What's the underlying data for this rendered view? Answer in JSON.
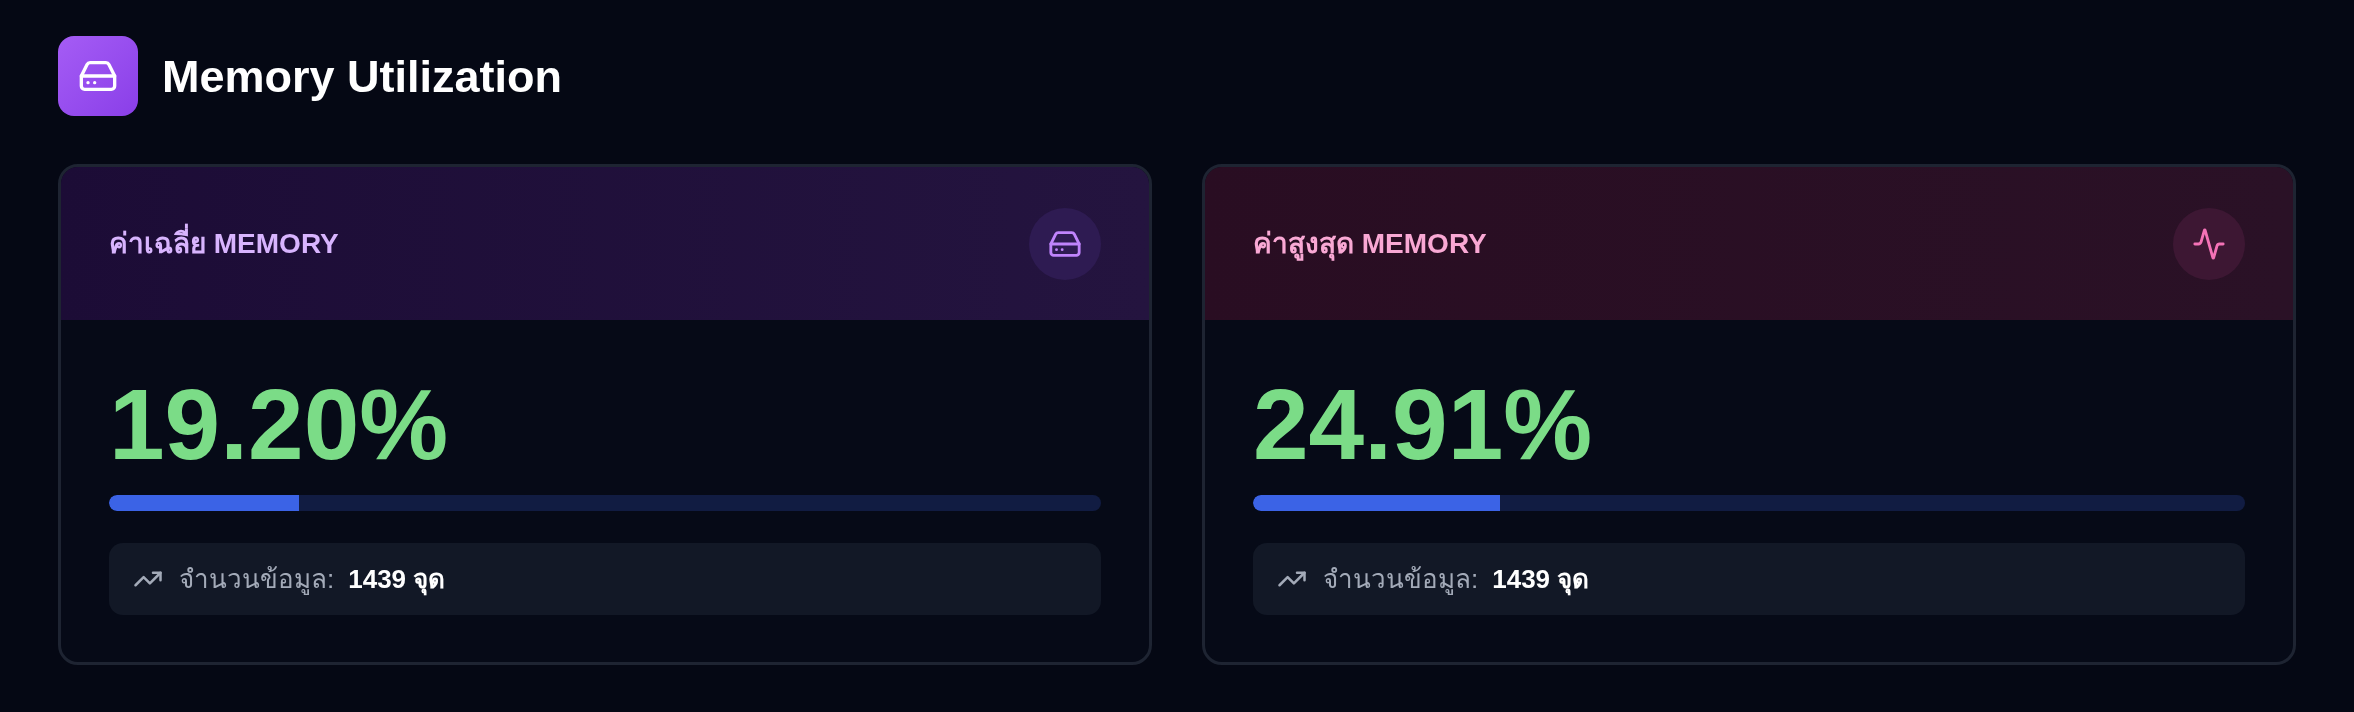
{
  "header": {
    "title": "Memory Utilization"
  },
  "cards": [
    {
      "kind": "average",
      "label": "ค่าเฉลี่ย MEMORY",
      "value": "19.20%",
      "level": 0.192,
      "count_label": "จำนวนข้อมูล:",
      "count_value": "1439 จุด"
    },
    {
      "kind": "peak",
      "label": "ค่าสูงสุด MEMORY",
      "value": "24.91%",
      "level": 0.2491,
      "count_label": "จำนวนข้อมูล:",
      "count_value": "1439 จุด"
    }
  ]
}
